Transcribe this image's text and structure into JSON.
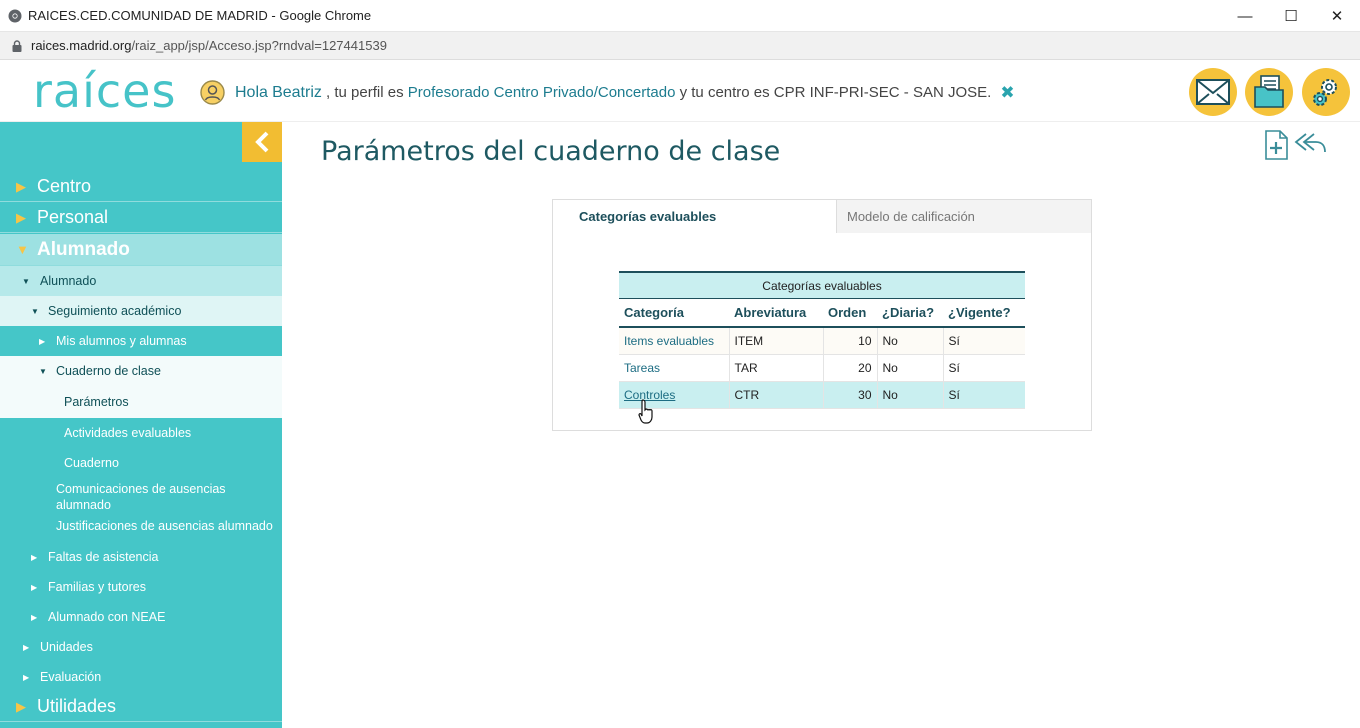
{
  "browser": {
    "title": "RAICES.CED.COMUNIDAD DE MADRID - Google Chrome",
    "url_host": "raices.madrid.org",
    "url_path": "/raiz_app/jsp/Acceso.jsp?rndval=127441539",
    "controls": [
      "minimize",
      "maximize",
      "close"
    ]
  },
  "header": {
    "logo_text": "raíces",
    "greeting_prefix": "Hola",
    "user_name": "Beatriz",
    "profile_text": ", tu perfil es",
    "profile": "Profesorado Centro Privado/Concertado",
    "center_text": "y tu centro es CPR INF-PRI-SEC - SAN JOSE.",
    "close_symbol": "✖",
    "buttons": [
      "envelope-icon",
      "documents-icon",
      "settings-icon"
    ],
    "accent_color": "#f5c33b"
  },
  "sidebar": {
    "color": "#45c6c8",
    "items": [
      {
        "label": "Centro"
      },
      {
        "label": "Personal"
      },
      {
        "label": "Alumnado"
      },
      {
        "label": "Alumnado"
      },
      {
        "label": "Seguimiento académico"
      },
      {
        "label": "Mis alumnos y alumnas"
      },
      {
        "label": "Cuaderno de clase"
      },
      {
        "label": "Parámetros"
      },
      {
        "label": "Actividades evaluables"
      },
      {
        "label": "Cuaderno"
      },
      {
        "label": "Comunicaciones de ausencias alumnado"
      },
      {
        "label": "Justificaciones de ausencias alumnado"
      },
      {
        "label": "Faltas de asistencia"
      },
      {
        "label": "Familias y tutores"
      },
      {
        "label": "Alumnado con NEAE"
      },
      {
        "label": "Unidades"
      },
      {
        "label": "Evaluación"
      },
      {
        "label": "Utilidades"
      }
    ]
  },
  "main": {
    "title": "Parámetros del cuaderno de clase",
    "tabs": [
      {
        "label": "Categorías evaluables",
        "active": true
      },
      {
        "label": "Modelo de calificación",
        "active": false
      }
    ],
    "table": {
      "caption": "Categorías evaluables",
      "headers": [
        "Categoría",
        "Abreviatura",
        "Orden",
        "¿Diaria?",
        "¿Vigente?"
      ],
      "rows": [
        {
          "categoria": "Items evaluables",
          "abrev": "ITEM",
          "orden": "10",
          "diaria": "No",
          "vigente": "Sí"
        },
        {
          "categoria": "Tareas",
          "abrev": "TAR",
          "orden": "20",
          "diaria": "No",
          "vigente": "Sí"
        },
        {
          "categoria": "Controles",
          "abrev": "CTR",
          "orden": "30",
          "diaria": "No",
          "vigente": "Sí"
        }
      ]
    }
  }
}
